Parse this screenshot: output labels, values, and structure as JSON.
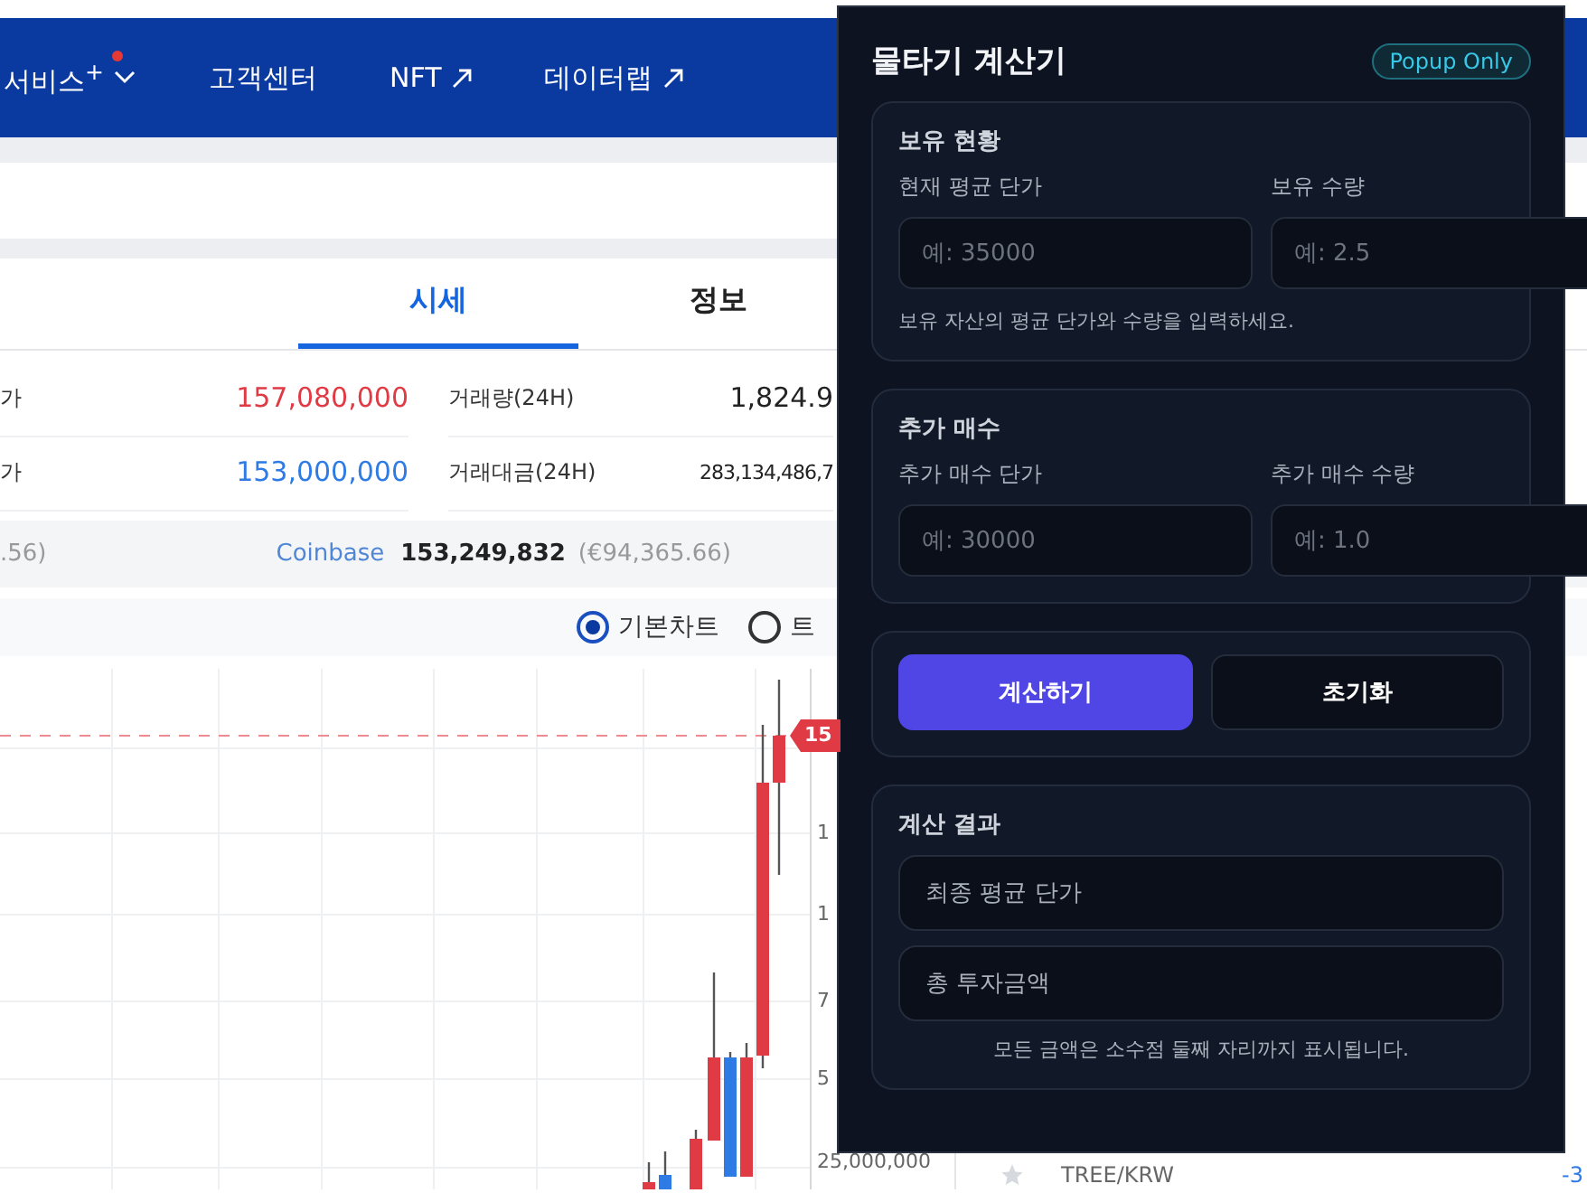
{
  "nav": {
    "items": [
      {
        "label": "서비스$^{+}$",
        "kind": "dropdown",
        "badge": true
      },
      {
        "label": "고객센터",
        "kind": "plain",
        "badge": false
      },
      {
        "label": "NFT",
        "kind": "external",
        "badge": false
      },
      {
        "label": "데이터랩",
        "kind": "external",
        "badge": false
      }
    ]
  },
  "tabs": [
    {
      "label": "시세",
      "selected": true
    },
    {
      "label": "정보",
      "selected": false
    }
  ],
  "stats": [
    {
      "label": "가",
      "value": "157,080,000",
      "color": "#e03a45",
      "label_2": "거래량(24H)",
      "value_2": "1,824.9"
    },
    {
      "label": "가",
      "value": "153,000,000",
      "color": "#2f7be5",
      "label_2": "거래대금(24H)",
      "value_2": "283,134,486,7"
    }
  ],
  "exchange_bar": {
    "partial": ".56)",
    "exchange": "Coinbase",
    "price": "153,249,832",
    "converted": "(€94,365.66)"
  },
  "chart_types": [
    {
      "label": "기본차트",
      "selected": true
    },
    {
      "label": "트",
      "selected": false
    }
  ],
  "chart": {
    "price_tag": "15",
    "axis_labels": [
      "1",
      "1",
      "7",
      "5"
    ],
    "bottom_label": "25,000,000"
  },
  "market_list": [
    {
      "pair": "TREE/KRW",
      "change": "-3"
    }
  ],
  "popup": {
    "title": "물타기 계산기",
    "badge": "Popup Only",
    "sections": [
      {
        "title": "보유 현황",
        "fields": [
          {
            "label": "현재 평균 단가",
            "placeholder": "예: 35000"
          },
          {
            "label": "보유 수량",
            "placeholder": "예: 2.5"
          }
        ],
        "hint": "보유 자산의 평균 단가와 수량을 입력하세요."
      },
      {
        "title": "추가 매수",
        "fields": [
          {
            "label": "추가 매수 단가",
            "placeholder": "예: 30000"
          },
          {
            "label": "추가 매수 수량",
            "placeholder": "예: 1.0"
          }
        ]
      }
    ],
    "buttons": [
      {
        "label": "계산하기",
        "kind": "primary"
      },
      {
        "label": "초기화",
        "kind": "secondary"
      }
    ],
    "result": {
      "title": "계산 결과",
      "rows": [
        "최종 평균 단가",
        "총 투자금액"
      ],
      "note": "모든 금액은 소수점 둘째 자리까지 표시됩니다."
    }
  }
}
